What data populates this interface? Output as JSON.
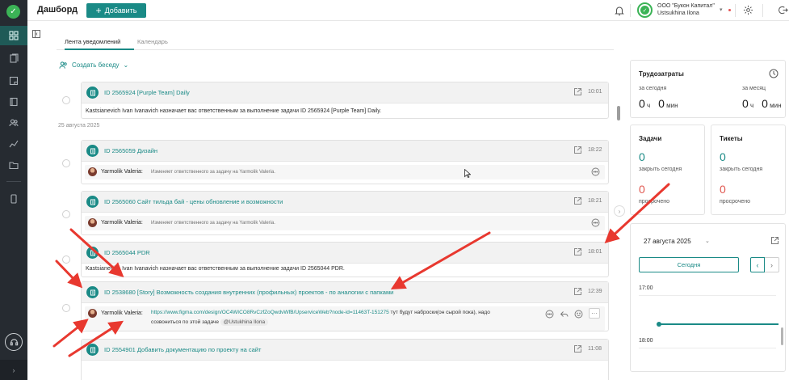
{
  "app": {
    "page_title": "Дашборд",
    "add_button": "Добавить"
  },
  "header": {
    "org_name": "ООО \"Букон Капитал\"",
    "user_name": "Ustsukhina Ilona"
  },
  "tabs": [
    {
      "label": "Лента уведомлений",
      "active": true
    },
    {
      "label": "Календарь",
      "active": false
    }
  ],
  "feed": {
    "create_chat": "Создать беседу",
    "date_separator": "25 августа 2025",
    "cards": [
      {
        "title": "ID 2565924 [Purple Team] Daily",
        "time": "10:01",
        "text": "Kastsianevich Ivan Ivanavich назначает вас ответственным за выполнение задачи ID 2565924 [Purple Team] Daily."
      },
      {
        "title": "ID 2565059 Дизайн",
        "time": "18:22",
        "comment_author": "Yarmolik Valeria:",
        "comment_text": "Изменяет ответственного за задачу на Yarmolik Valeria."
      },
      {
        "title": "ID 2565060 Сайт тильда бай - цены обновление и возможности",
        "time": "18:21",
        "comment_author": "Yarmolik Valeria:",
        "comment_text": "Изменяет ответственного за задачу на Yarmolik Valeria."
      },
      {
        "title": "ID 2565044 PDR",
        "time": "18:01",
        "text": "Kastsianevich Ivan Ivanavich назначает вас ответственным за выполнение задачи ID 2565044 PDR."
      },
      {
        "title": "ID 2538680 [Story] Возможность создания внутренних (профильных) проектов - по аналогии с папками",
        "time": "12:39",
        "comment_author": "Yarmolik Valeria:",
        "comment_link": "https://www.figma.com/design/OC4WICO8RvCzfZoQwdvWfB/UpserviceWeb?node-id=11463T-151275",
        "comment_text_after": " тут будут наброски(он сырой пока), надо",
        "comment_text_line2": "созвониться по этой задаче",
        "comment_mention": "@Ustukhina Ilona"
      },
      {
        "title": "ID 2554901 Добавить документацию по проекту на сайт",
        "time": "11:08"
      }
    ]
  },
  "time_panel": {
    "title": "Трудозатраты",
    "today_label": "за сегодня",
    "month_label": "за месяц",
    "today_h": "0",
    "today_m": "0",
    "month_h": "0",
    "month_m": "0",
    "h_unit": "ч",
    "m_unit": "мин"
  },
  "tasks_panel": {
    "title": "Задачи",
    "close_today_value": "0",
    "close_today_label": "закрыть сегодня",
    "overdue_value": "0",
    "overdue_label": "просрочено"
  },
  "tickets_panel": {
    "title": "Тикеты",
    "close_today_value": "0",
    "close_today_label": "закрыть сегодня",
    "overdue_value": "0",
    "overdue_label": "просрочено"
  },
  "calendar": {
    "date": "27 августа 2025",
    "today_button": "Сегодня",
    "prev": "‹",
    "next": "›",
    "hours": [
      "17:00",
      "18:00"
    ]
  },
  "colors": {
    "accent": "#1a8a86",
    "danger": "#e0574f",
    "rail": "#262b31",
    "annotation": "#e8382f"
  }
}
